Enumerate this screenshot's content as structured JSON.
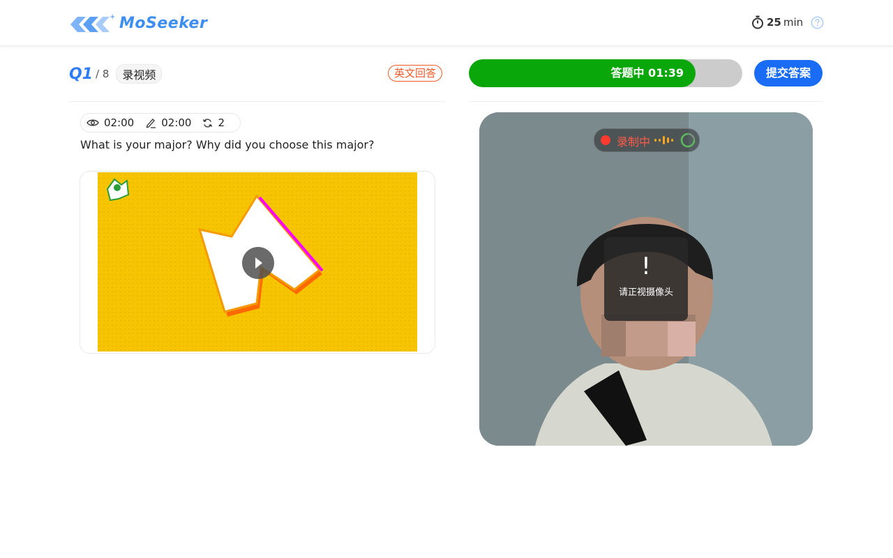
{
  "header": {
    "logo_text": "MoSeeker",
    "timer_value": "25",
    "timer_unit": "min"
  },
  "question": {
    "number": "Q1",
    "total": "/ 8",
    "type_label": "录视频",
    "english_answer_label": "英文回答",
    "view_time": "02:00",
    "answer_time": "02:00",
    "retries": "2",
    "text": "What is your major? Why did you choose this major?"
  },
  "answer": {
    "progress_label": "答题中 01:39",
    "progress_fraction": 0.83,
    "submit_label": "提交答案"
  },
  "camera": {
    "recording_label": "录制中",
    "warning_mark": "!",
    "warning_text": "请正视摄像头"
  },
  "colors": {
    "brand": "#3d8ef0",
    "progress_fill": "#0aa70a",
    "submit": "#1a6cf4",
    "english_tag": "#f15a29",
    "recording": "#ff3b30"
  }
}
